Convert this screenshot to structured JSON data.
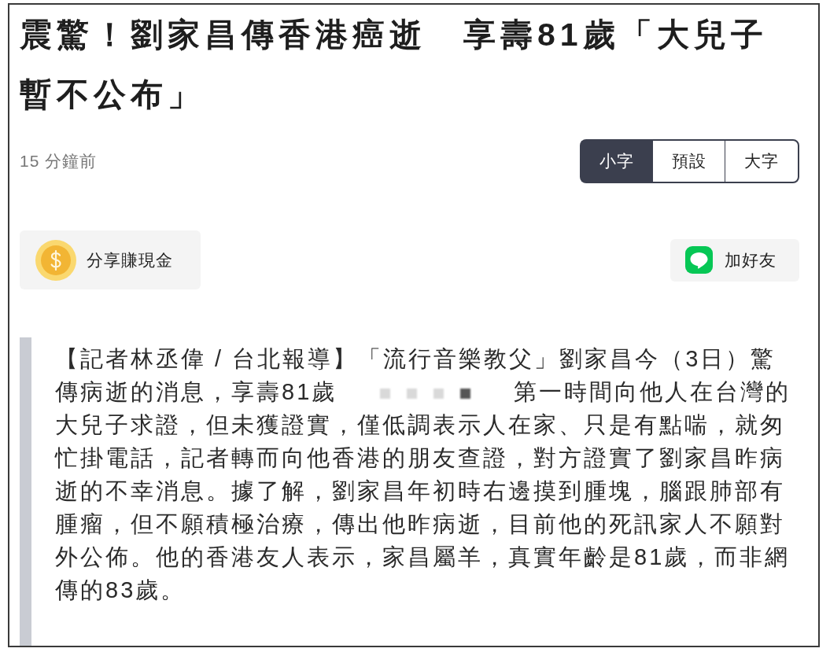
{
  "article": {
    "title": "震驚！劉家昌傳香港癌逝　享壽81歲「大兒子暫不公布」",
    "time_ago": "15 分鐘前",
    "font_size_options": [
      {
        "label": "小字",
        "selected": true
      },
      {
        "label": "預設",
        "selected": false
      },
      {
        "label": "大字",
        "selected": false
      }
    ],
    "share_button": {
      "label": "分享賺現金"
    },
    "add_friend_button": {
      "label": "加好友"
    },
    "body": {
      "text_before_blur": "【記者林丞偉 / 台北報導】「流行音樂教父」劉家昌今（3日）驚傳病逝的消息，享壽81歲",
      "text_after_blur": "第一時間向他人在台灣的大兒子求證，但未獲證實，僅低調表示人在家、只是有點喘，就匆忙掛電話，記者轉而向他香港的朋友查證，對方證實了劉家昌昨病逝的不幸消息。據了解，劉家昌年初時右邊摸到腫塊，腦跟肺部有腫瘤，但不願積極治療，傳出他昨病逝，目前他的死訊家人不願對外公佈。他的香港友人表示，家昌屬羊，真實年齡是81歲，而非網傳的83歲。"
    }
  }
}
